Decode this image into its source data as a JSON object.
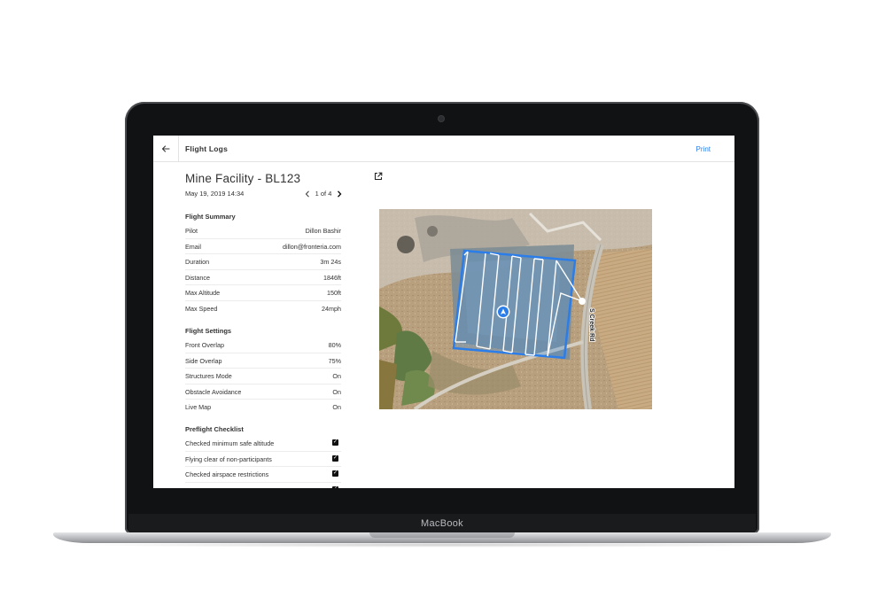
{
  "device": {
    "brand": "MacBook"
  },
  "topbar": {
    "title": "Flight Logs",
    "print_label": "Print",
    "back_icon": "arrow-left-icon"
  },
  "header": {
    "title": "Mine Facility - BL123",
    "date": "May 19, 2019 14:34",
    "pager": "1 of 4"
  },
  "flight_summary": {
    "title": "Flight Summary",
    "rows": [
      {
        "label": "Pilot",
        "value": "Dillon Bashir"
      },
      {
        "label": "Email",
        "value": "dillon@fronteria.com"
      },
      {
        "label": "Duration",
        "value": "3m 24s"
      },
      {
        "label": "Distance",
        "value": "1846ft"
      },
      {
        "label": "Max Altitude",
        "value": "150ft"
      },
      {
        "label": "Max Speed",
        "value": "24mph"
      }
    ]
  },
  "flight_settings": {
    "title": "Flight Settings",
    "rows": [
      {
        "label": "Front Overlap",
        "value": "80%"
      },
      {
        "label": "Side Overlap",
        "value": "75%"
      },
      {
        "label": "Structures Mode",
        "value": "On"
      },
      {
        "label": "Obstacle Avoidance",
        "value": "On"
      },
      {
        "label": "Live Map",
        "value": "On"
      }
    ]
  },
  "preflight_checklist": {
    "title": "Preflight Checklist",
    "items": [
      {
        "label": "Checked minimum safe altitude",
        "checked": true
      },
      {
        "label": "Flying clear of non-participants",
        "checked": true
      },
      {
        "label": "Checked airspace restrictions",
        "checked": true
      }
    ]
  },
  "map": {
    "road_label": "S Creek Rd",
    "flight_area_color": "#2b7de9",
    "marker_color": "#2b7de9"
  }
}
